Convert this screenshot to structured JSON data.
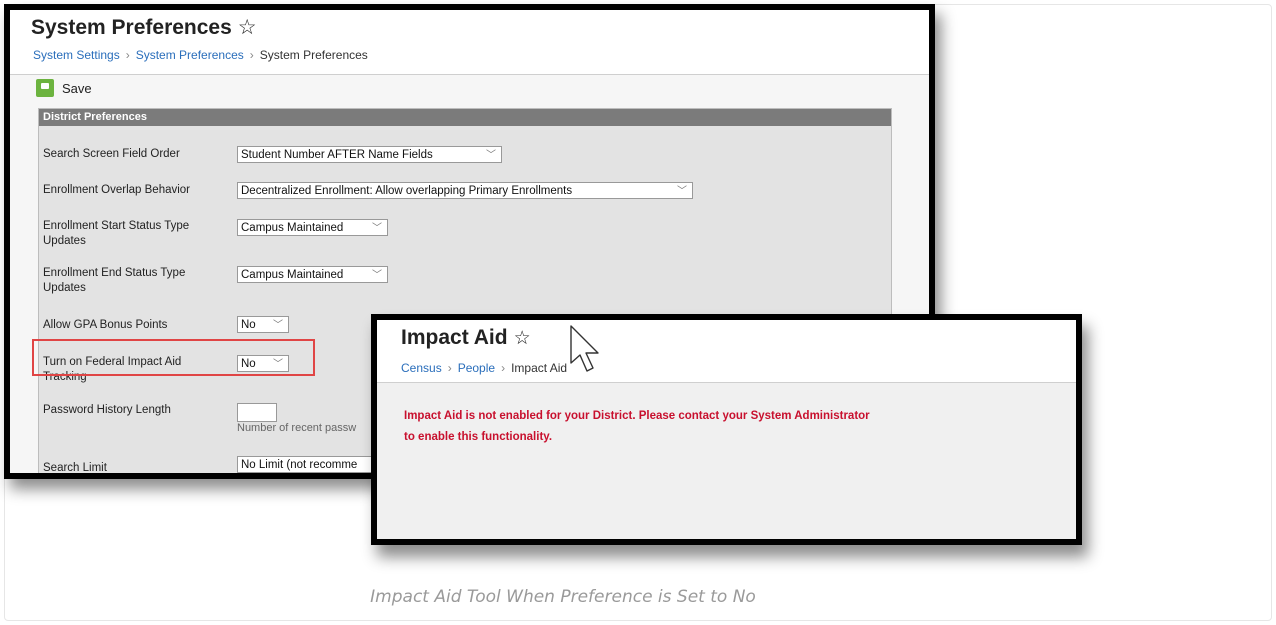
{
  "system_prefs": {
    "title": "System Preferences",
    "star": "☆",
    "breadcrumb": [
      "System Settings",
      "System Preferences",
      "System Preferences"
    ],
    "save_label": "Save",
    "section_header": "District Preferences",
    "fields": [
      {
        "label": "Search Screen Field Order",
        "value": "Student Number AFTER Name Fields"
      },
      {
        "label": "Enrollment Overlap Behavior",
        "value": "Decentralized Enrollment: Allow overlapping Primary Enrollments"
      },
      {
        "label": "Enrollment Start Status Type Updates",
        "value": "Campus Maintained"
      },
      {
        "label": "Enrollment End Status Type Updates",
        "value": "Campus Maintained"
      },
      {
        "label": "Allow GPA Bonus Points",
        "value": "No"
      },
      {
        "label": "Turn on Federal Impact Aid Tracking",
        "value": "No"
      },
      {
        "label": "Password History Length",
        "value": "",
        "hint": "Number of recent passw"
      },
      {
        "label": "Search Limit",
        "value": "No Limit (not recomme"
      }
    ]
  },
  "impact_aid": {
    "title": "Impact Aid",
    "star": "☆",
    "breadcrumb": [
      "Census",
      "People",
      "Impact Aid"
    ],
    "message": "Impact Aid is not enabled for your District. Please contact your System Administrator to enable this functionality."
  },
  "caption": "Impact Aid Tool When Preference is Set to No",
  "colors": {
    "link": "#2a6ebb",
    "error": "#c8102e",
    "highlight": "#e04545",
    "save": "#6cb33f",
    "section_header": "#7b7b7b"
  }
}
